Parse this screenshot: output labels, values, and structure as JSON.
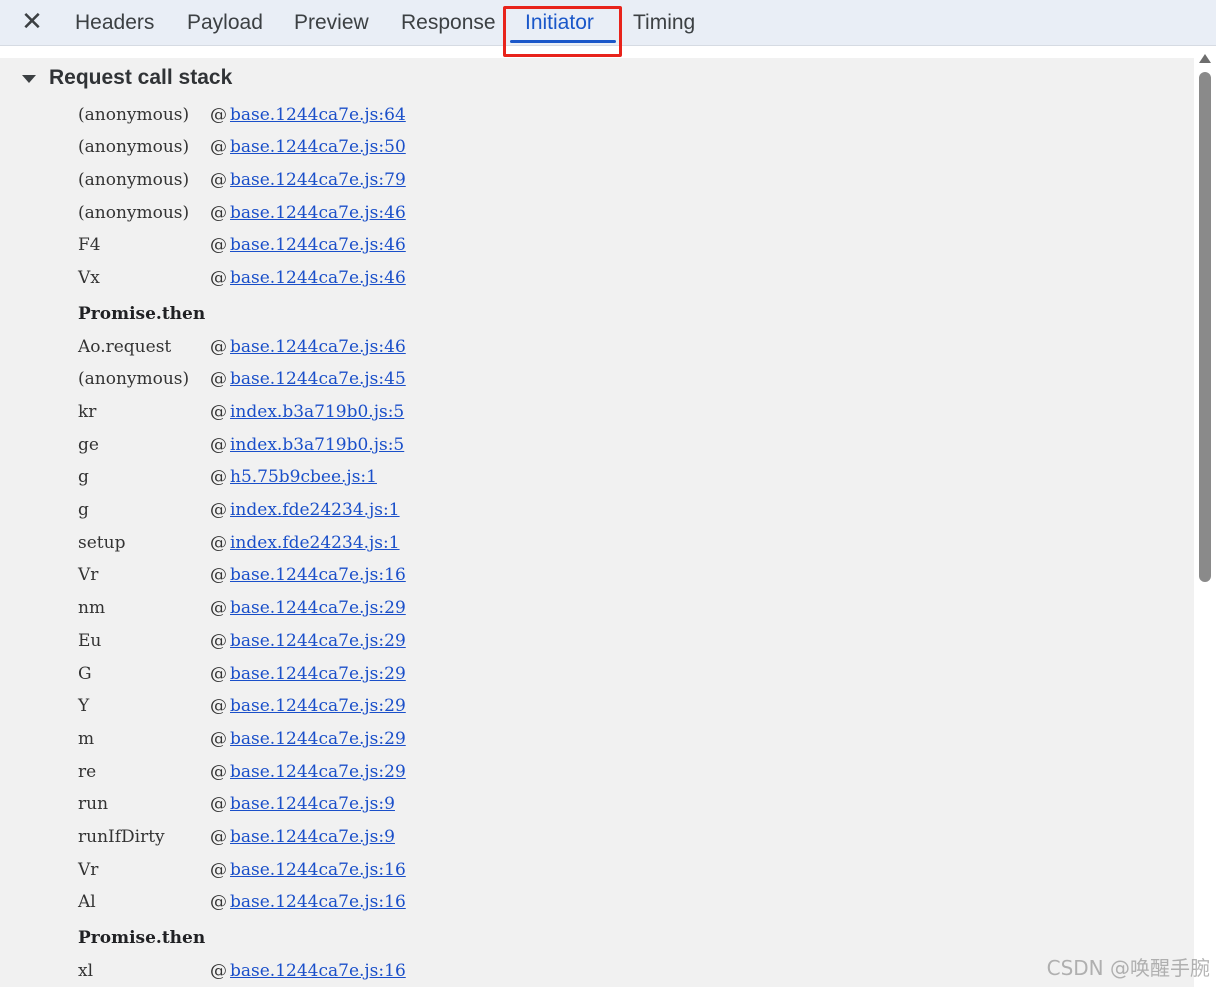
{
  "tabs": [
    {
      "label": "Headers",
      "active": false
    },
    {
      "label": "Payload",
      "active": false
    },
    {
      "label": "Preview",
      "active": false
    },
    {
      "label": "Response",
      "active": false
    },
    {
      "label": "Initiator",
      "active": true
    },
    {
      "label": "Timing",
      "active": false
    }
  ],
  "close_icon": "close-icon",
  "section": {
    "title": "Request call stack",
    "expanded": true
  },
  "frames": [
    {
      "fn": "(anonymous)",
      "at": "@",
      "link": "base.1244ca7e.js:64"
    },
    {
      "fn": "(anonymous)",
      "at": "@",
      "link": "base.1244ca7e.js:50"
    },
    {
      "fn": "(anonymous)",
      "at": "@",
      "link": "base.1244ca7e.js:79"
    },
    {
      "fn": "(anonymous)",
      "at": "@",
      "link": "base.1244ca7e.js:46"
    },
    {
      "fn": "F4",
      "at": "@",
      "link": "base.1244ca7e.js:46"
    },
    {
      "fn": "Vx",
      "at": "@",
      "link": "base.1244ca7e.js:46"
    },
    {
      "async": "Promise.then"
    },
    {
      "fn": "Ao.request",
      "at": "@",
      "link": "base.1244ca7e.js:46"
    },
    {
      "fn": "(anonymous)",
      "at": "@",
      "link": "base.1244ca7e.js:45"
    },
    {
      "fn": "kr",
      "at": "@",
      "link": "index.b3a719b0.js:5"
    },
    {
      "fn": "ge",
      "at": "@",
      "link": "index.b3a719b0.js:5"
    },
    {
      "fn": "g",
      "at": "@",
      "link": "h5.75b9cbee.js:1"
    },
    {
      "fn": "g",
      "at": "@",
      "link": "index.fde24234.js:1"
    },
    {
      "fn": "setup",
      "at": "@",
      "link": "index.fde24234.js:1"
    },
    {
      "fn": "Vr",
      "at": "@",
      "link": "base.1244ca7e.js:16"
    },
    {
      "fn": "nm",
      "at": "@",
      "link": "base.1244ca7e.js:29"
    },
    {
      "fn": "Eu",
      "at": "@",
      "link": "base.1244ca7e.js:29"
    },
    {
      "fn": "G",
      "at": "@",
      "link": "base.1244ca7e.js:29"
    },
    {
      "fn": "Y",
      "at": "@",
      "link": "base.1244ca7e.js:29"
    },
    {
      "fn": "m",
      "at": "@",
      "link": "base.1244ca7e.js:29"
    },
    {
      "fn": "re",
      "at": "@",
      "link": "base.1244ca7e.js:29"
    },
    {
      "fn": "run",
      "at": "@",
      "link": "base.1244ca7e.js:9"
    },
    {
      "fn": "runIfDirty",
      "at": "@",
      "link": "base.1244ca7e.js:9"
    },
    {
      "fn": "Vr",
      "at": "@",
      "link": "base.1244ca7e.js:16"
    },
    {
      "fn": "Al",
      "at": "@",
      "link": "base.1244ca7e.js:16"
    },
    {
      "async": "Promise.then"
    },
    {
      "fn": "xl",
      "at": "@",
      "link": "base.1244ca7e.js:16"
    }
  ],
  "watermark": "CSDN @唤醒手腕",
  "colors": {
    "accent": "#1a57c9",
    "highlight": "#e8231b",
    "link": "#1a4fc9"
  }
}
